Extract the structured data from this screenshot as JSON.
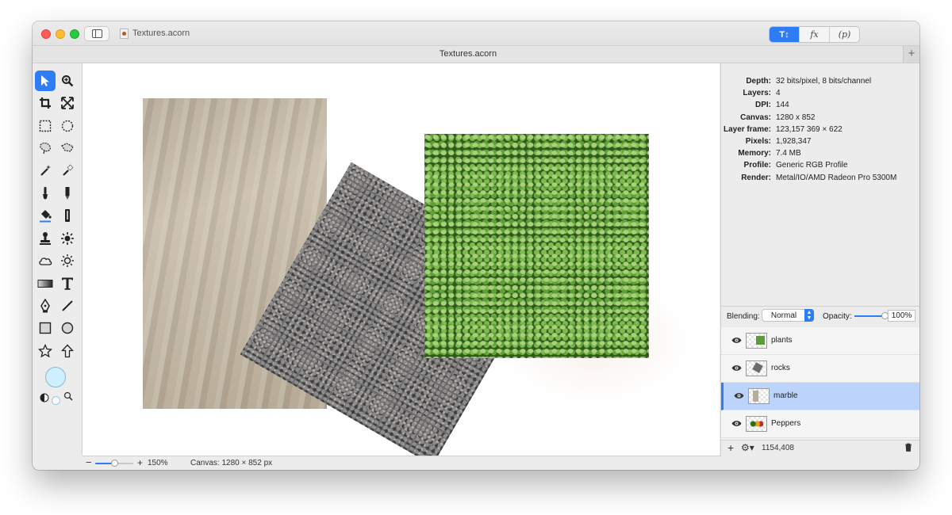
{
  "window": {
    "title": "Textures.acorn",
    "tab_title": "Textures.acorn",
    "tab_add": "+",
    "toolbar_segments": [
      {
        "label": "T",
        "active": true
      },
      {
        "label": "fx",
        "active": false
      },
      {
        "label": "(p)",
        "active": false
      }
    ]
  },
  "tools": [
    "select-arrow",
    "zoom",
    "crop",
    "transform",
    "rect-select",
    "ellipse-select",
    "lasso",
    "poly-lasso",
    "magic-wand",
    "magic-brush",
    "brush",
    "pencil",
    "paint-bucket",
    "gradient-fill",
    "clone-stamp",
    "dodge-burn",
    "cloud",
    "sun",
    "gradient",
    "text",
    "bezier-pen",
    "line",
    "rectangle",
    "ellipse",
    "star",
    "arrow-shape"
  ],
  "colors": {
    "accent": "#2f7df6",
    "foreground": "#cdefff",
    "selected_row": "#bcd4fb"
  },
  "inspector": {
    "rows": [
      {
        "key": "Depth:",
        "value": "32 bits/pixel, 8 bits/channel"
      },
      {
        "key": "Layers:",
        "value": "4"
      },
      {
        "key": "DPI:",
        "value": "144"
      },
      {
        "key": "Canvas:",
        "value": "1280 x 852"
      },
      {
        "key": "Layer frame:",
        "value": "123,157 369 × 622"
      },
      {
        "key": "Pixels:",
        "value": "1,928,347"
      },
      {
        "key": "Memory:",
        "value": "7.4 MB"
      },
      {
        "key": "Profile:",
        "value": "Generic RGB Profile"
      },
      {
        "key": "Render:",
        "value": "Metal/IO/AMD Radeon Pro 5300M"
      }
    ]
  },
  "blending": {
    "label": "Blending:",
    "mode": "Normal",
    "opacity_label": "Opacity:",
    "opacity": "100%",
    "opacity_value": 1.0
  },
  "layers": [
    {
      "name": "plants",
      "selected": false
    },
    {
      "name": "rocks",
      "selected": false
    },
    {
      "name": "marble",
      "selected": true
    },
    {
      "name": "Peppers",
      "selected": false
    }
  ],
  "layers_footer": {
    "add": "+",
    "gear": "⚙▾",
    "coords": "1154,408"
  },
  "status": {
    "zoom_minus": "−",
    "zoom_plus": "+",
    "zoom": "150%",
    "zoom_fraction": 0.5,
    "canvas": "Canvas: 1280 × 852 px"
  }
}
